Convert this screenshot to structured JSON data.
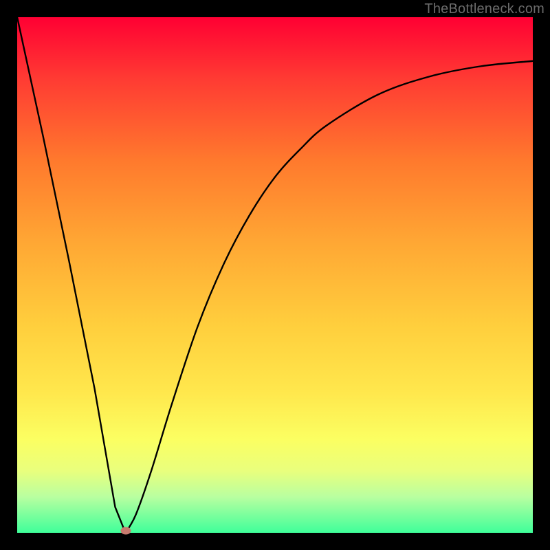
{
  "watermark": "TheBottleneck.com",
  "chart_data": {
    "type": "line",
    "title": "",
    "xlabel": "",
    "ylabel": "",
    "xlim": [
      0,
      1
    ],
    "ylim": [
      0,
      1
    ],
    "grid": false,
    "legend": false,
    "series": [
      {
        "name": "bottleneck-curve",
        "x": [
          0.0,
          0.05,
          0.1,
          0.15,
          0.19,
          0.21,
          0.23,
          0.26,
          0.3,
          0.35,
          0.4,
          0.45,
          0.5,
          0.55,
          0.6,
          0.7,
          0.8,
          0.9,
          1.0
        ],
        "y": [
          1.0,
          0.77,
          0.53,
          0.28,
          0.05,
          0.0,
          0.035,
          0.12,
          0.25,
          0.4,
          0.52,
          0.615,
          0.69,
          0.745,
          0.79,
          0.85,
          0.885,
          0.905,
          0.915
        ]
      }
    ],
    "annotations": [
      {
        "kind": "marker",
        "x": 0.21,
        "y": 0.0,
        "color": "#c87a6e"
      }
    ],
    "background_gradient": [
      {
        "stop": 0.0,
        "color": "#ff0033"
      },
      {
        "stop": 0.6,
        "color": "#ffcf3d"
      },
      {
        "stop": 0.82,
        "color": "#fbff62"
      },
      {
        "stop": 1.0,
        "color": "#3fff9a"
      }
    ]
  },
  "colors": {
    "curve_stroke": "#000000",
    "frame_bg": "#000000",
    "watermark": "#6b6b6b",
    "marker": "#c87a6e"
  }
}
